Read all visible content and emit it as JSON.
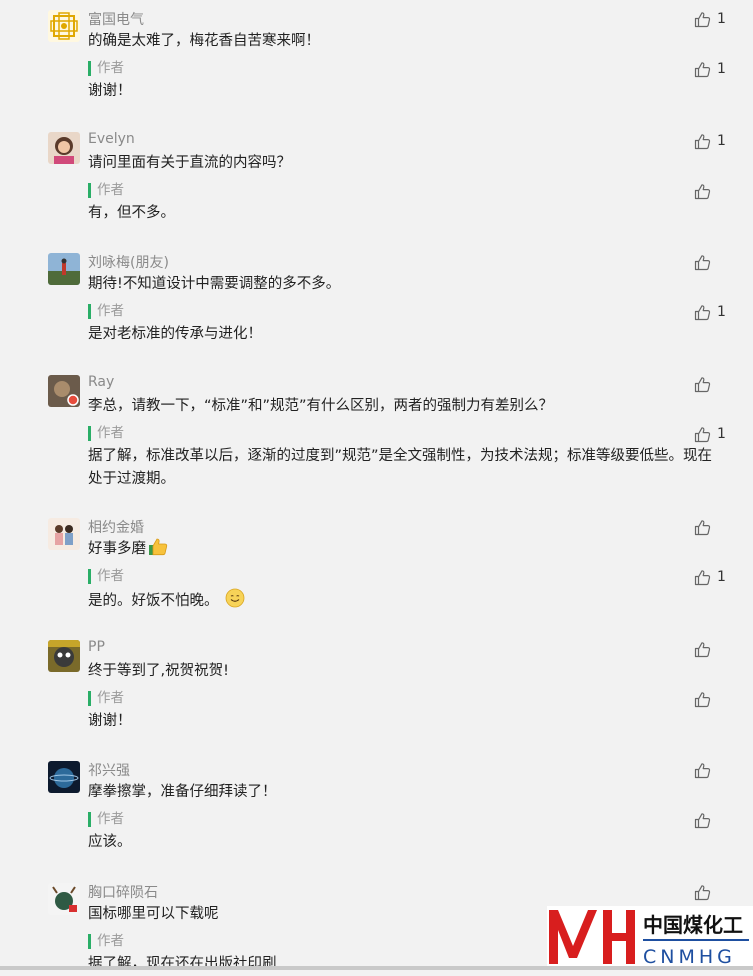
{
  "colors": {
    "author_bar": "#2aae67",
    "logo_red": "#d81e1e",
    "logo_blue": "#1e4fa0"
  },
  "icons": {
    "like": "thumbs-up-icon"
  },
  "comments": [
    {
      "nickname": "富国电气",
      "text": "的确是太难了，梅花香自苦寒来啊！",
      "likes": "1",
      "reply": {
        "author_label": "作者",
        "text": "谢谢！",
        "likes": "1"
      }
    },
    {
      "nickname": "Evelyn",
      "text": "请问里面有关于直流的内容吗？",
      "likes": "1",
      "reply": {
        "author_label": "作者",
        "text": "有，但不多。",
        "likes": ""
      }
    },
    {
      "nickname": "刘咏梅(朋友)",
      "text": "期待!不知道设计中需要调整的多不多。",
      "likes": "",
      "reply": {
        "author_label": "作者",
        "text": "是对老标准的传承与进化！",
        "likes": "1"
      }
    },
    {
      "nickname": "Ray",
      "text": "李总，请教一下，“标准”和”规范”有什么区别，两者的强制力有差别么？",
      "likes": "",
      "reply": {
        "author_label": "作者",
        "text": "据了解，标准改革以后，逐渐的过度到”规范”是全文强制性，为技术法规；标准等级要低些。现在处于过渡期。",
        "likes": "1"
      }
    },
    {
      "nickname": "相约金婚",
      "text": "好事多磨",
      "likes": "",
      "reply": {
        "author_label": "作者",
        "text": "是的。好饭不怕晚。",
        "likes": "1"
      }
    },
    {
      "nickname": "PP",
      "text": "终于等到了,祝贺祝贺!",
      "likes": "",
      "reply": {
        "author_label": "作者",
        "text": "谢谢！",
        "likes": ""
      }
    },
    {
      "nickname": "祁兴强",
      "text": "摩拳擦掌，准备仔细拜读了！",
      "likes": "",
      "reply": {
        "author_label": "作者",
        "text": "应该。",
        "likes": ""
      }
    },
    {
      "nickname": "胸口碎陨石",
      "text": "国标哪里可以下载呢",
      "likes": "",
      "reply": {
        "author_label": "作者",
        "text": "据了解，现在还在出版社印刷",
        "likes": ""
      }
    }
  ],
  "watermark": {
    "name_cn": "中国煤化工",
    "name_en": "CNMHG"
  }
}
